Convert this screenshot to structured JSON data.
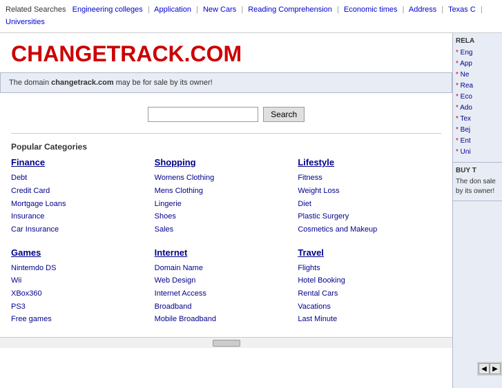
{
  "related_bar": {
    "label": "Related Searches",
    "links": [
      "Engineering colleges",
      "Application",
      "New Cars",
      "Reading Comprehension",
      "Economic times",
      "Address",
      "Texas C",
      "Universities"
    ]
  },
  "logo": {
    "text": "CHANGETRACK.COM"
  },
  "domain_notice": {
    "prefix": "The domain ",
    "domain": "changetrack.com",
    "suffix": " may be for sale by its owner!"
  },
  "search": {
    "placeholder": "",
    "button_label": "Search"
  },
  "popular_categories": {
    "label": "Popular Categories",
    "groups": [
      {
        "title": "Finance",
        "links": [
          "Debt",
          "Credit Card",
          "Mortgage Loans",
          "Insurance",
          "Car Insurance"
        ]
      },
      {
        "title": "Shopping",
        "links": [
          "Womens Clothing",
          "Mens Clothing",
          "Lingerie",
          "Shoes",
          "Sales"
        ]
      },
      {
        "title": "Lifestyle",
        "links": [
          "Fitness",
          "Weight Loss",
          "Diet",
          "Plastic Surgery",
          "Cosmetics and Makeup"
        ]
      },
      {
        "title": "Games",
        "links": [
          "Nintemdo DS",
          "Wii",
          "XBox360",
          "PS3",
          "Free games"
        ]
      },
      {
        "title": "Internet",
        "links": [
          "Domain Name",
          "Web Design",
          "Internet Access",
          "Broadband",
          "Mobile Broadband"
        ]
      },
      {
        "title": "Travel",
        "links": [
          "Flights",
          "Hotel Booking",
          "Rental Cars",
          "Vacations",
          "Last Minute"
        ]
      }
    ]
  },
  "sidebar": {
    "related_title": "RELA",
    "related_links": [
      "Eng",
      "App",
      "Ne",
      "Rea",
      "Eco",
      "Ado",
      "Tex",
      "Bej",
      "Ent",
      "Uni"
    ],
    "buy_title": "BUY T",
    "buy_text": "The don sale by its owner!"
  }
}
